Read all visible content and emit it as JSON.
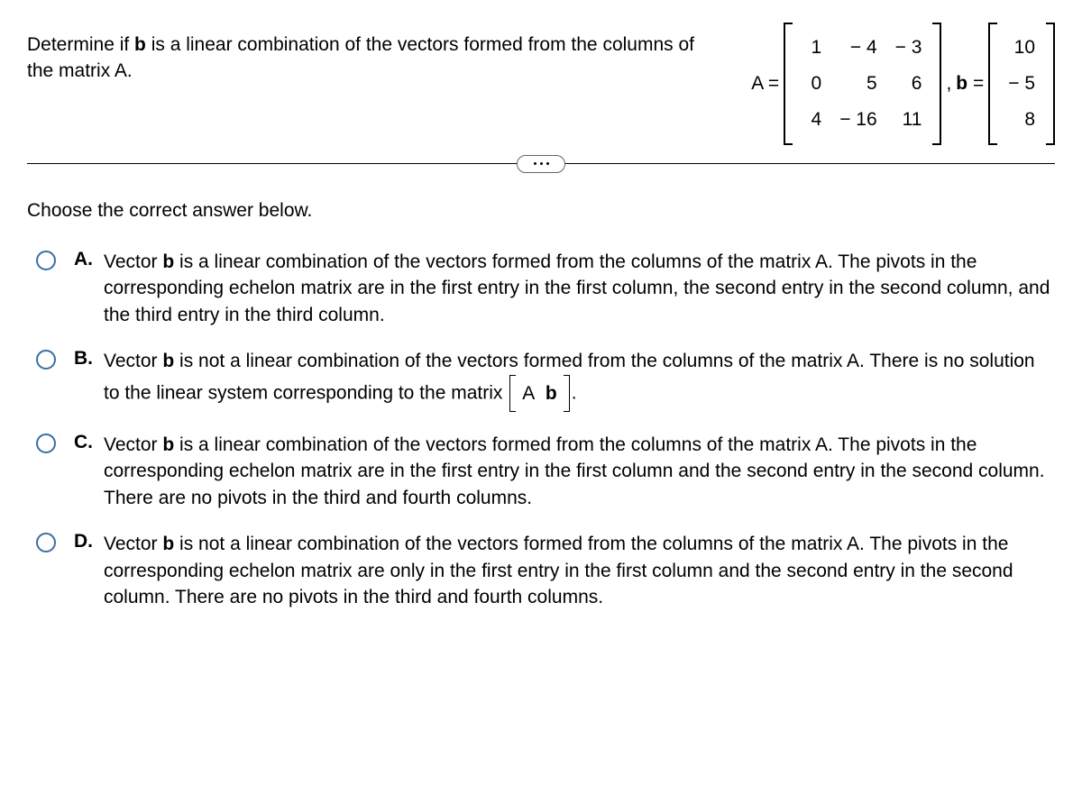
{
  "question": {
    "text_part1": "Determine if ",
    "text_bold1": "b",
    "text_part2": " is a linear combination of the vectors formed from the columns of the matrix A."
  },
  "matrixA": {
    "label": "A =",
    "rows": [
      [
        "1",
        "− 4",
        "− 3"
      ],
      [
        "0",
        "5",
        "6"
      ],
      [
        "4",
        "− 16",
        "11"
      ]
    ]
  },
  "separator": ",",
  "vectorB": {
    "label_prefix": "b",
    "label_suffix": " =",
    "rows": [
      [
        "10"
      ],
      [
        "− 5"
      ],
      [
        "8"
      ]
    ]
  },
  "instruction": "Choose the correct answer below.",
  "options": {
    "A": {
      "letter": "A.",
      "pre1": "Vector ",
      "bold1": "b",
      "post1": " is a linear combination of the vectors formed from the columns of the matrix A. The pivots in the corresponding echelon matrix are in the first entry in the first column, the second entry in the second column, and the third entry in the third column."
    },
    "B": {
      "letter": "B.",
      "pre1": "Vector ",
      "bold1": "b",
      "mid1": " is not a linear combination of the vectors formed from the columns of the matrix A. There is no solution to the linear system corresponding to the matrix ",
      "matrix_A": "A",
      "matrix_b": "b",
      "post1": "."
    },
    "C": {
      "letter": "C.",
      "pre1": "Vector ",
      "bold1": "b",
      "post1": " is a linear combination of the vectors formed from the columns of the matrix A. The pivots in the corresponding echelon matrix are in the first entry in the first column and the second entry in the second column. There are no pivots in the third and fourth columns."
    },
    "D": {
      "letter": "D.",
      "pre1": "Vector ",
      "bold1": "b",
      "post1": " is not a linear combination of the vectors formed from the columns of the matrix A. The pivots in the corresponding echelon matrix are only in the first entry in the first column and the second entry in the second column. There are no pivots in the third and fourth columns."
    }
  }
}
